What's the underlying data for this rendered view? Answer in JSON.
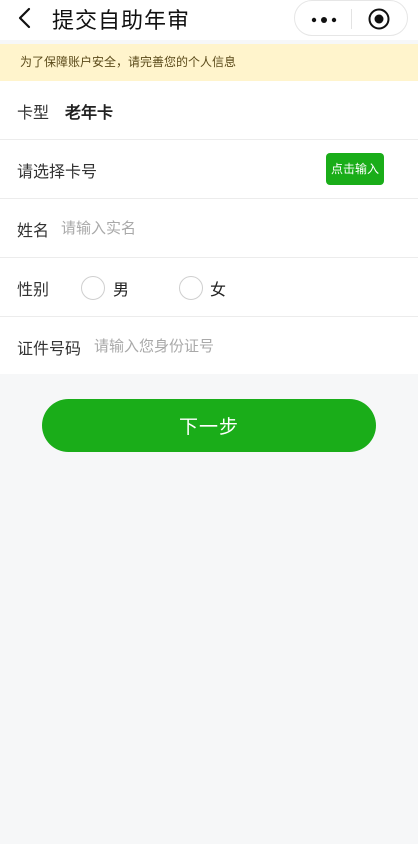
{
  "header": {
    "title": "提交自助年审",
    "back_icon": "chevron-left-icon",
    "more_icon": "more-dots-icon",
    "close_icon": "target-circle-icon"
  },
  "notice": {
    "text": "为了保障账户安全，请完善您的个人信息",
    "background": "#fff4cc"
  },
  "form": {
    "card_type": {
      "label": "卡型",
      "value": "老年卡"
    },
    "card_number": {
      "label": "请选择卡号",
      "button_label": "点击输入"
    },
    "name": {
      "label": "姓名",
      "placeholder": "请输入实名"
    },
    "gender": {
      "label": "性别",
      "options": [
        "男",
        "女"
      ]
    },
    "id_number": {
      "label": "证件号码",
      "placeholder": "请输入您身份证号"
    }
  },
  "actions": {
    "next_label": "下一步"
  },
  "colors": {
    "primary": "#1aad19",
    "background": "#f6f7f8"
  }
}
